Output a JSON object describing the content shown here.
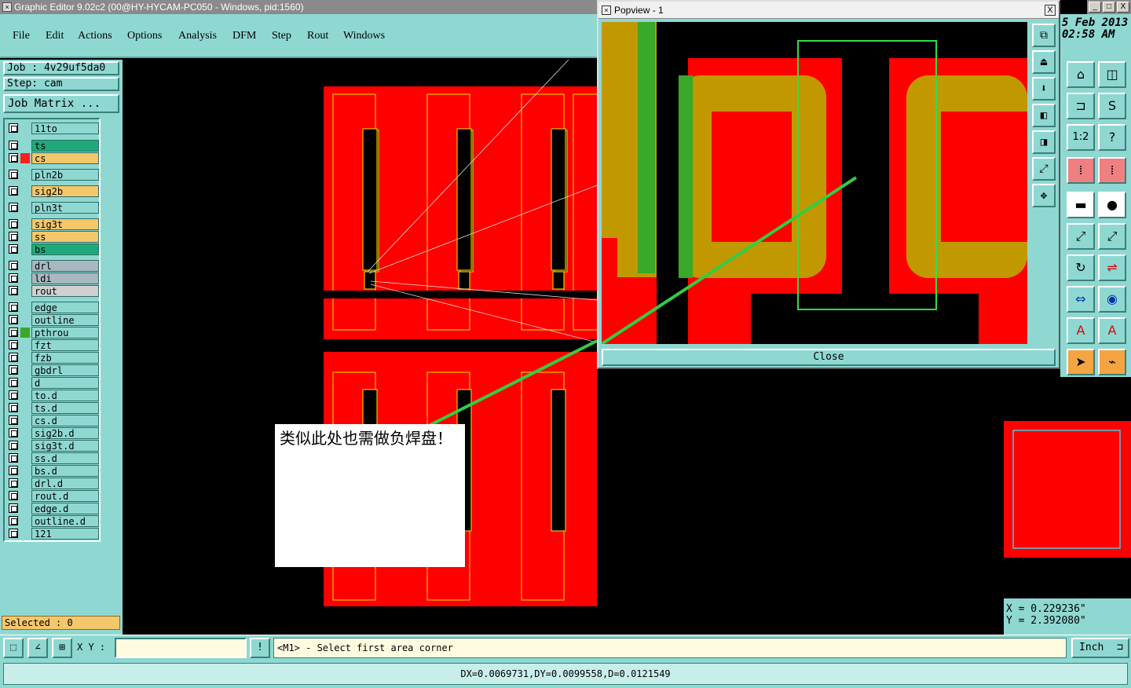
{
  "window": {
    "title": "Graphic Editor 9.02c2 (00@HY-HYCAM-PC050 - Windows, pid:1560)",
    "btn_min": "_",
    "btn_max": "□",
    "btn_close": "X"
  },
  "menu": [
    "File",
    "Edit",
    "Actions",
    "Options",
    "Analysis",
    "DFM",
    "Step",
    "Rout",
    "Windows"
  ],
  "job": {
    "job": "Job : 4v29uf5da0",
    "step": "Step: cam",
    "matrix_button": "Job Matrix ..."
  },
  "layers": [
    {
      "name": "11to",
      "color": "#8fd8d2",
      "bg": "#8fd8d2"
    },
    {
      "name": "ts",
      "color": "#8fd8d2",
      "bg": "#1fa97a"
    },
    {
      "name": "cs",
      "color": "#ff1e1e",
      "bg": "#f4c76b"
    },
    {
      "name": "pln2b",
      "color": "#8fd8d2",
      "bg": "#8fd8d2"
    },
    {
      "name": "sig2b",
      "color": "#8fd8d2",
      "bg": "#f4c76b"
    },
    {
      "name": "pln3t",
      "color": "#8fd8d2",
      "bg": "#8fd8d2"
    },
    {
      "name": "sig3t",
      "color": "#8fd8d2",
      "bg": "#f4c76b"
    },
    {
      "name": "ss",
      "color": "#8fd8d2",
      "bg": "#f4c76b"
    },
    {
      "name": "bs",
      "color": "#8fd8d2",
      "bg": "#1fa97a"
    },
    {
      "name": "drl",
      "color": "#8fd8d2",
      "bg": "#a8b8c0"
    },
    {
      "name": "ldi",
      "color": "#8fd8d2",
      "bg": "#a8b8c0"
    },
    {
      "name": "rout",
      "color": "#8fd8d2",
      "bg": "#d0d0d0"
    },
    {
      "name": "edge",
      "color": "#8fd8d2",
      "bg": "#8fd8d2"
    },
    {
      "name": "outline",
      "color": "#8fd8d2",
      "bg": "#8fd8d2"
    },
    {
      "name": "pthrou",
      "color": "#3aa828",
      "bg": "#8fd8d2"
    },
    {
      "name": "fzt",
      "color": "#8fd8d2",
      "bg": "#8fd8d2"
    },
    {
      "name": "fzb",
      "color": "#8fd8d2",
      "bg": "#8fd8d2"
    },
    {
      "name": "gbdrl",
      "color": "#8fd8d2",
      "bg": "#8fd8d2"
    },
    {
      "name": "d",
      "color": "#8fd8d2",
      "bg": "#8fd8d2"
    },
    {
      "name": "to.d",
      "color": "#8fd8d2",
      "bg": "#8fd8d2"
    },
    {
      "name": "ts.d",
      "color": "#8fd8d2",
      "bg": "#8fd8d2"
    },
    {
      "name": "cs.d",
      "color": "#8fd8d2",
      "bg": "#8fd8d2"
    },
    {
      "name": "sig2b.d",
      "color": "#8fd8d2",
      "bg": "#8fd8d2"
    },
    {
      "name": "sig3t.d",
      "color": "#8fd8d2",
      "bg": "#8fd8d2"
    },
    {
      "name": "ss.d",
      "color": "#8fd8d2",
      "bg": "#8fd8d2"
    },
    {
      "name": "bs.d",
      "color": "#8fd8d2",
      "bg": "#8fd8d2"
    },
    {
      "name": "drl.d",
      "color": "#8fd8d2",
      "bg": "#8fd8d2"
    },
    {
      "name": "rout.d",
      "color": "#8fd8d2",
      "bg": "#8fd8d2"
    },
    {
      "name": "edge.d",
      "color": "#8fd8d2",
      "bg": "#8fd8d2"
    },
    {
      "name": "outline.d",
      "color": "#8fd8d2",
      "bg": "#8fd8d2"
    },
    {
      "name": "121",
      "color": "#8fd8d2",
      "bg": "#8fd8d2"
    }
  ],
  "selected": "Selected : 0",
  "popview": {
    "title": "Popview - 1",
    "close_x": "X",
    "close_button": "Close"
  },
  "date": {
    "line1": "5 Feb 2013",
    "line2": "02:58 AM"
  },
  "coords": {
    "x": "X = 0.229236\"",
    "y": "Y = 2.392080\""
  },
  "cmd": {
    "xy_label": "X Y :",
    "xy_value": "",
    "bang": "!",
    "prompt": "<M1> - Select first area corner",
    "unit": "Inch"
  },
  "status": "DX=0.0069731,DY=0.0099558,D=0.0121549",
  "note": "类似此处也需做负焊盘！",
  "colors": {
    "panel": "#8fd8d2",
    "copper": "#ff0000",
    "outline": "#e8c200",
    "measure_line": "#33cc44"
  }
}
